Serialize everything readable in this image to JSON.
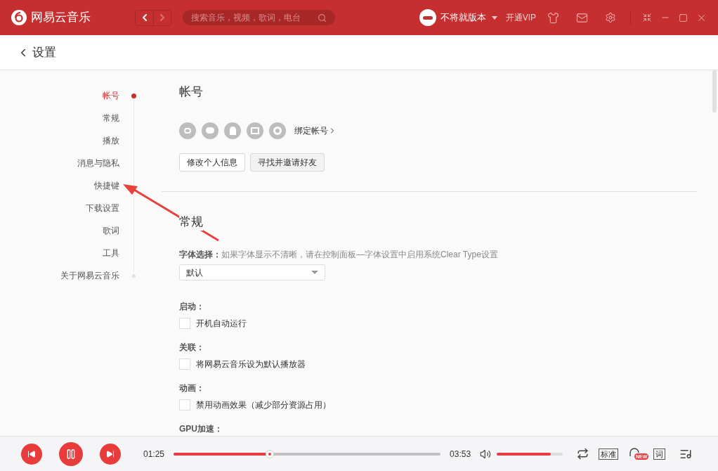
{
  "topbar": {
    "app_name": "网易云音乐",
    "search": {
      "placeholder": "搜索音乐，视频，歌词，电台"
    },
    "user_name": "不将就版本",
    "vip": "开通VIP"
  },
  "page_title": "设置",
  "nav": [
    {
      "label": "帐号",
      "selected": true
    },
    {
      "label": "常规",
      "selected": false
    },
    {
      "label": "播放",
      "selected": false
    },
    {
      "label": "消息与隐私",
      "selected": false
    },
    {
      "label": "快捷键",
      "selected": false
    },
    {
      "label": "下载设置",
      "selected": false
    },
    {
      "label": "歌词",
      "selected": false
    },
    {
      "label": "工具",
      "selected": false
    },
    {
      "label": "关于网易云音乐",
      "selected": false
    }
  ],
  "account": {
    "title": "帐号",
    "bind_label": "绑定帐号",
    "buttons": [
      "修改个人信息",
      "寻找并邀请好友"
    ]
  },
  "general": {
    "title": "常规",
    "font": {
      "label": "字体选择：",
      "hint": "如果字体显示不清晰，请在控制面板—字体设置中启用系统Clear Type设置",
      "value": "默认"
    },
    "groups": [
      {
        "label": "启动：",
        "option": "开机自动运行",
        "checked": false
      },
      {
        "label": "关联：",
        "option": "将网易云音乐设为默认播放器",
        "checked": false
      },
      {
        "label": "动画：",
        "option": "禁用动画效果（减少部分资源占用）",
        "checked": false
      },
      {
        "label": "GPU加速："
      }
    ]
  },
  "player": {
    "elapsed": "01:25",
    "total": "03:53",
    "progress": {
      "level": 0.36
    },
    "volume": {
      "level": 0.82
    },
    "quality": "标准",
    "badge": "NEW",
    "lyrics": "词"
  }
}
